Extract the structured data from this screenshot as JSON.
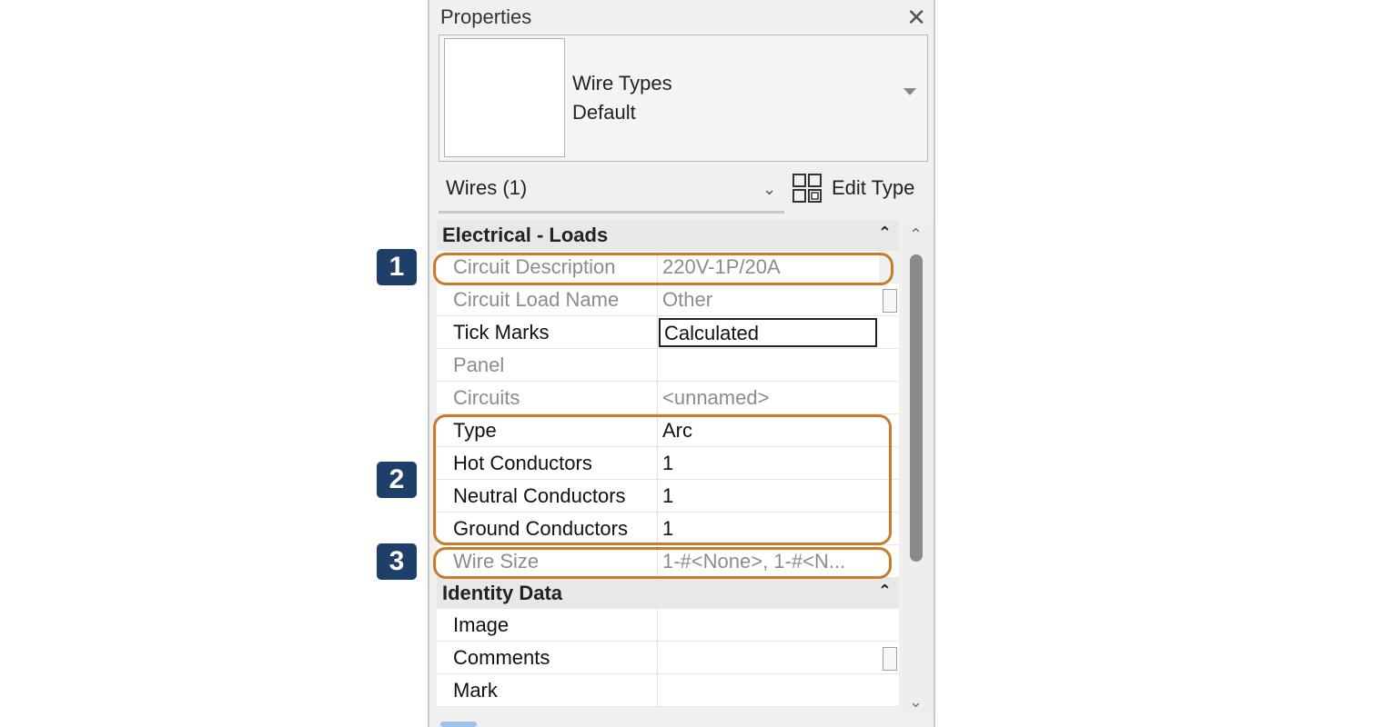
{
  "panel": {
    "title": "Properties",
    "close_icon": "close-icon"
  },
  "type_selector": {
    "family": "Wire Types",
    "type": "Default"
  },
  "instance_selector": {
    "label": "Wires (1)",
    "edit_type_label": "Edit Type"
  },
  "groups": [
    {
      "title": "Electrical - Loads",
      "rows": [
        {
          "name": "Circuit Description",
          "value": "220V-1P/20A"
        },
        {
          "name": "Circuit Load Name",
          "value": "Other"
        },
        {
          "name": "Tick Marks",
          "value": "Calculated"
        },
        {
          "name": "Panel",
          "value": ""
        },
        {
          "name": "Circuits",
          "value": "<unnamed>"
        },
        {
          "name": "Type",
          "value": "Arc"
        },
        {
          "name": "Hot Conductors",
          "value": "1"
        },
        {
          "name": "Neutral Conductors",
          "value": "1"
        },
        {
          "name": "Ground Conductors",
          "value": "1"
        },
        {
          "name": "Wire Size",
          "value": "1-#<None>, 1-#<N..."
        }
      ]
    },
    {
      "title": "Identity Data",
      "rows": [
        {
          "name": "Image",
          "value": ""
        },
        {
          "name": "Comments",
          "value": ""
        },
        {
          "name": "Mark",
          "value": ""
        }
      ]
    }
  ],
  "callouts": [
    "1",
    "2",
    "3"
  ],
  "colors": {
    "highlight": "#c97a2b",
    "badge": "#1f3f6b"
  }
}
